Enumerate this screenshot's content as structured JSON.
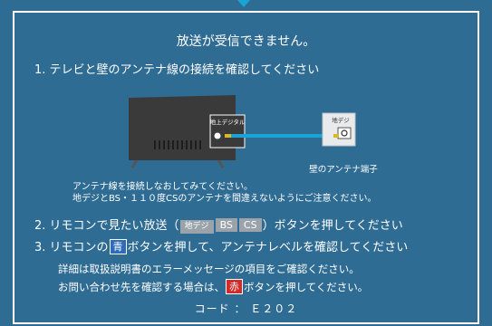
{
  "message": {
    "title": "放送が受信できません。",
    "step1": "1.  テレビと壁のアンテナ線の接続を確認してください",
    "tv_port_label": "地上デジタル",
    "wall_port_label": "地デジ",
    "wall_outlet_label": "壁のアンテナ端子",
    "note_line1": "アンテナ線を接続しなおしてみてください。",
    "note_line2": "地デジとBS・１１０度CSのアンテナを間違えないようにご注意ください。",
    "step2_prefix": "2.  リモコンで見たい放送（",
    "step2_suffix": "）ボタンを押してください",
    "step3_prefix": "3.  リモコンの",
    "step3_suffix": "ボタンを押して、アンテナレベルを確認してください",
    "detail_line1": "詳細は取扱説明書のエラーメッセージの項目をご確認ください。",
    "detail_line2_prefix": "お問い合わせ先を確認する場合は、",
    "detail_line2_suffix": "ボタンを押してください。",
    "error_code": "コード ： Ｅ２０２"
  },
  "buttons": {
    "terrestrial": "地デジ",
    "bs": "BS",
    "cs": "CS",
    "blue": "青",
    "red": "赤"
  },
  "colors": {
    "background": "#2f6c93",
    "cable": "#1aa3d6",
    "tv_body": "#3a3a3a",
    "blue_button": "#2c6cb8",
    "red_button": "#d32a2a",
    "gray_button": "#9aa2aa"
  }
}
